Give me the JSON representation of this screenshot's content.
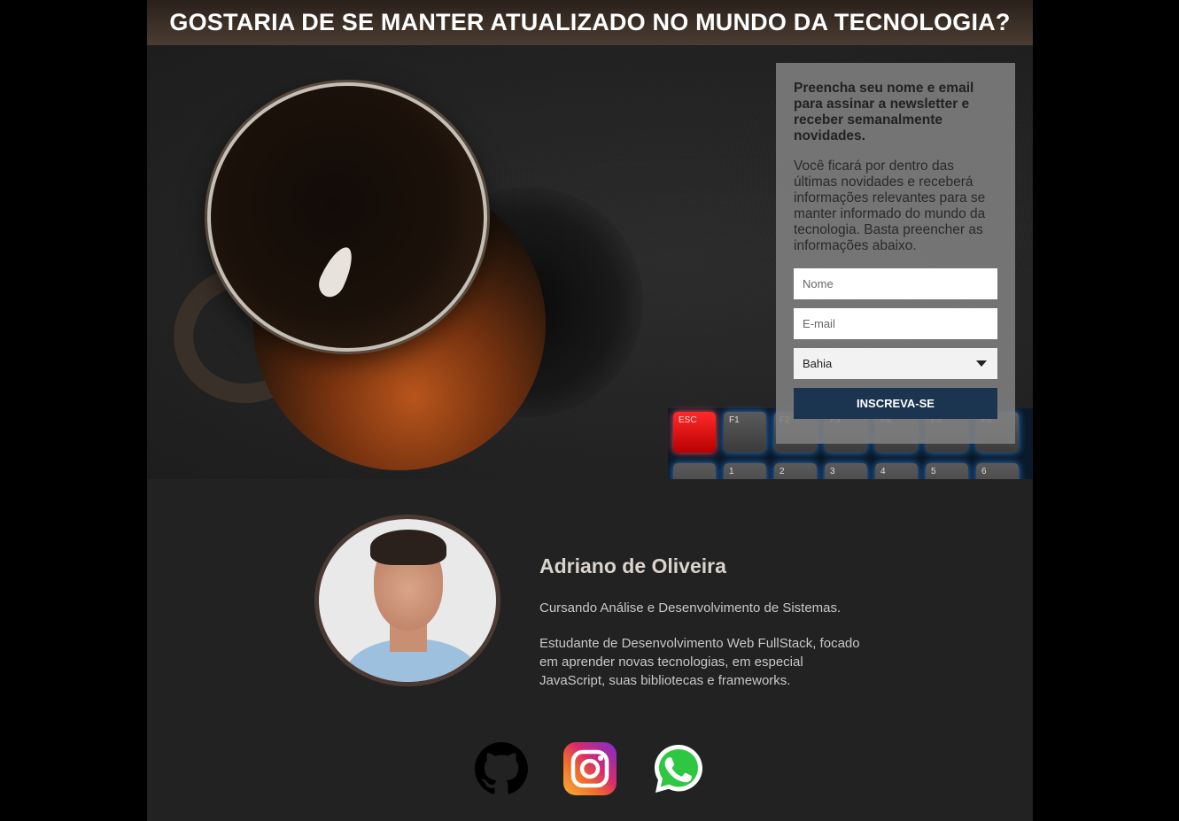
{
  "banner": {
    "title": "GOSTARIA DE SE MANTER ATUALIZADO NO MUNDO DA TECNOLOGIA?"
  },
  "newsletter": {
    "heading": "Preencha seu nome e email para assinar a newsletter e receber semanalmente novidades.",
    "description": "Você ficará por dentro das últimas novidades e receberá informações relevantes para se manter informado do mundo da tecnologia. Basta preencher as informações abaixo.",
    "name_placeholder": "Nome",
    "email_placeholder": "E-mail",
    "state_selected": "Bahia",
    "submit_label": "INSCREVA-SE",
    "button_color": "#1b3550"
  },
  "keyboard": {
    "keys_row1": [
      "ESC",
      "F1",
      "F2",
      "F3",
      "F4",
      "F5",
      "F6"
    ],
    "keys_row2": [
      "",
      "1",
      "2",
      "3",
      "4",
      "5",
      "6"
    ]
  },
  "profile": {
    "name": "Adriano de Oliveira",
    "bio_line1": "Cursando Análise e Desenvolvimento de Sistemas.",
    "bio_line2": "Estudante de Desenvolvimento Web FullStack, focado em aprender novas tecnologias, em especial JavaScript, suas bibliotecas e frameworks."
  },
  "socials": [
    {
      "icon": "github-icon"
    },
    {
      "icon": "instagram-icon"
    },
    {
      "icon": "whatsapp-icon"
    }
  ]
}
